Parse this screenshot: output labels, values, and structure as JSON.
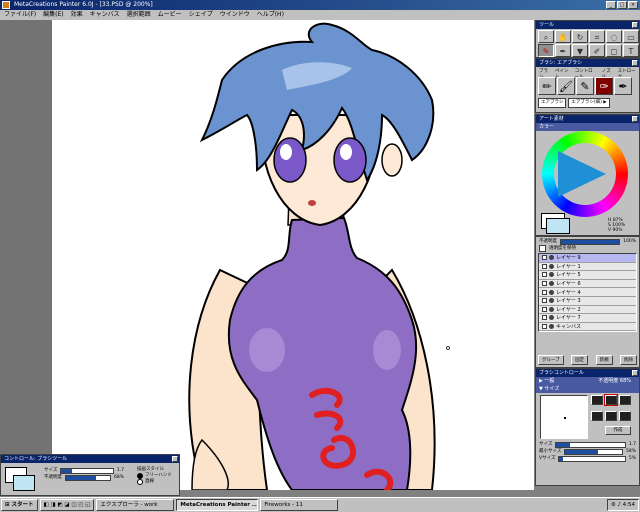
{
  "window": {
    "title": "MetaCreations Painter 6.0J - [33.PSD @ 200%]"
  },
  "menu": [
    "ファイル(F)",
    "編集(E)",
    "効果",
    "キャンバス",
    "選択範囲",
    "ムービー",
    "シェイプ",
    "ウインドウ",
    "ヘルプ(H)"
  ],
  "tools_palette": {
    "title": "ツール"
  },
  "brush_palette": {
    "title": "ブラシ: エアブラシ",
    "tabs": [
      "ブラシ",
      "ペイント",
      "コントロール",
      "ノズル",
      "ストローク"
    ],
    "category": "エアブラシ",
    "variant": "エアブラシ(細) ▶"
  },
  "art_palette": {
    "title": "アート素材",
    "color_tab": "カラー",
    "hsv": {
      "h": "H 87%",
      "s": "S 100%",
      "v": "V 90%"
    },
    "front_color": "#bfe4f3"
  },
  "layers_palette": {
    "opacity_label": "不透明度",
    "opacity_value": "100%",
    "preserve_label": "透明度を保持",
    "layers": [
      {
        "name": "レイヤー 9",
        "selected": true
      },
      {
        "name": "レイヤー 1",
        "selected": false
      },
      {
        "name": "レイヤー 5",
        "selected": false
      },
      {
        "name": "レイヤー 6",
        "selected": false
      },
      {
        "name": "レイヤー 4",
        "selected": false
      },
      {
        "name": "レイヤー 3",
        "selected": false
      },
      {
        "name": "レイヤー 2",
        "selected": false
      },
      {
        "name": "レイヤー 7",
        "selected": false
      },
      {
        "name": "キャンバス",
        "selected": false
      }
    ],
    "buttons": [
      "グループ",
      "固定",
      "新規",
      "削除"
    ]
  },
  "brush_control": {
    "title": "ブラシコントロール",
    "general_tab": "▶ 一般",
    "opacity_text": "不透明度 68%",
    "size_tab": "▼ サイズ",
    "size_label": "サイズ",
    "size_value": "1.7",
    "min_size_label": "最小サイズ",
    "min_size_value": "58%",
    "step_label": "Vサイズ",
    "step_value": "5%",
    "build_label": "作成"
  },
  "control_palette": {
    "title": "コントロール: ブラシツール",
    "size_label": "サイズ",
    "size_value": "1.7",
    "opacity_label": "不透明度",
    "opacity_value": "68%",
    "style_label": "描画スタイル",
    "style_options": [
      "フリーハンド",
      "直線"
    ]
  },
  "taskbar": {
    "start": "スタート",
    "tasks": [
      "エクスプローラ - work",
      "MetaCreations Painter ...",
      "Fireworks - 11"
    ],
    "clock": "4:54"
  }
}
